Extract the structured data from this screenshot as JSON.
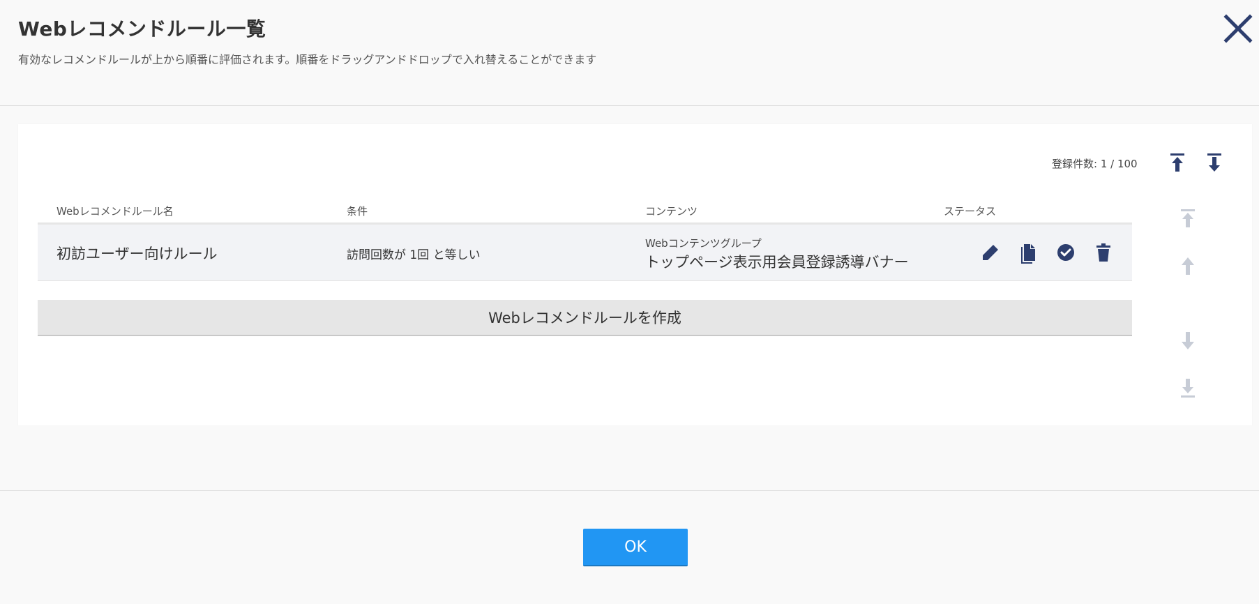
{
  "header": {
    "title": "Webレコメンドルール一覧",
    "subtitle": "有効なレコメンドルールが上から順番に評価されます。順番をドラッグアンドドロップで入れ替えることができます",
    "close_icon": "close-icon"
  },
  "summary": {
    "count_label": "登録件数: 1 / 100",
    "actions": [
      "move-to-top-icon",
      "move-to-bottom-icon"
    ]
  },
  "table": {
    "columns": [
      "Webレコメンドルール名",
      "条件",
      "コンテンツ",
      "ステータス"
    ],
    "rows": [
      {
        "name": "初訪ユーザー向けルール",
        "condition": "訪問回数が 1回 と等しい",
        "content_type": "Webコンテンツグループ",
        "content_name": "トップページ表示用会員登録誘導バナー",
        "actions": [
          "edit-icon",
          "copy-icon",
          "status-check-icon",
          "delete-icon"
        ]
      }
    ]
  },
  "create_button": {
    "label": "Webレコメンドルールを作成"
  },
  "side_controls": [
    "move-first-icon",
    "move-up-icon",
    "move-down-icon",
    "move-last-icon"
  ],
  "footer": {
    "ok_label": "OK"
  },
  "colors": {
    "accent": "#2196f3",
    "icon_dark": "#2d3e6e",
    "icon_disabled": "#c7ccd6",
    "row_bg": "#f2f3f6",
    "button_bg": "#e6e6e6"
  }
}
